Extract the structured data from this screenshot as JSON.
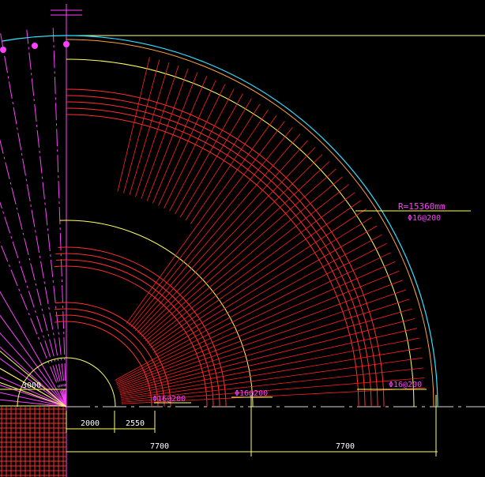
{
  "drawing": {
    "annotations": {
      "radius": "R=15360mm",
      "rebar_outer": "Φ16@200",
      "rebar_label_1": "Φ16@200",
      "rebar_label_2": "Φ16@200",
      "rebar_label_3": "Φ16@200",
      "rebar_label_4": "Φ16@200"
    },
    "dimensions": {
      "left_3000": "3000",
      "d_2000": "2000",
      "d_2550": "2550",
      "d_7700_a": "7700",
      "d_7700_b": "7700"
    },
    "colors": {
      "background": "#000000",
      "rebar": "#ff2020",
      "outline": "#ffff66",
      "text": "#ff40ff",
      "border": "#33e0ff",
      "center": "#ff00ff"
    }
  }
}
